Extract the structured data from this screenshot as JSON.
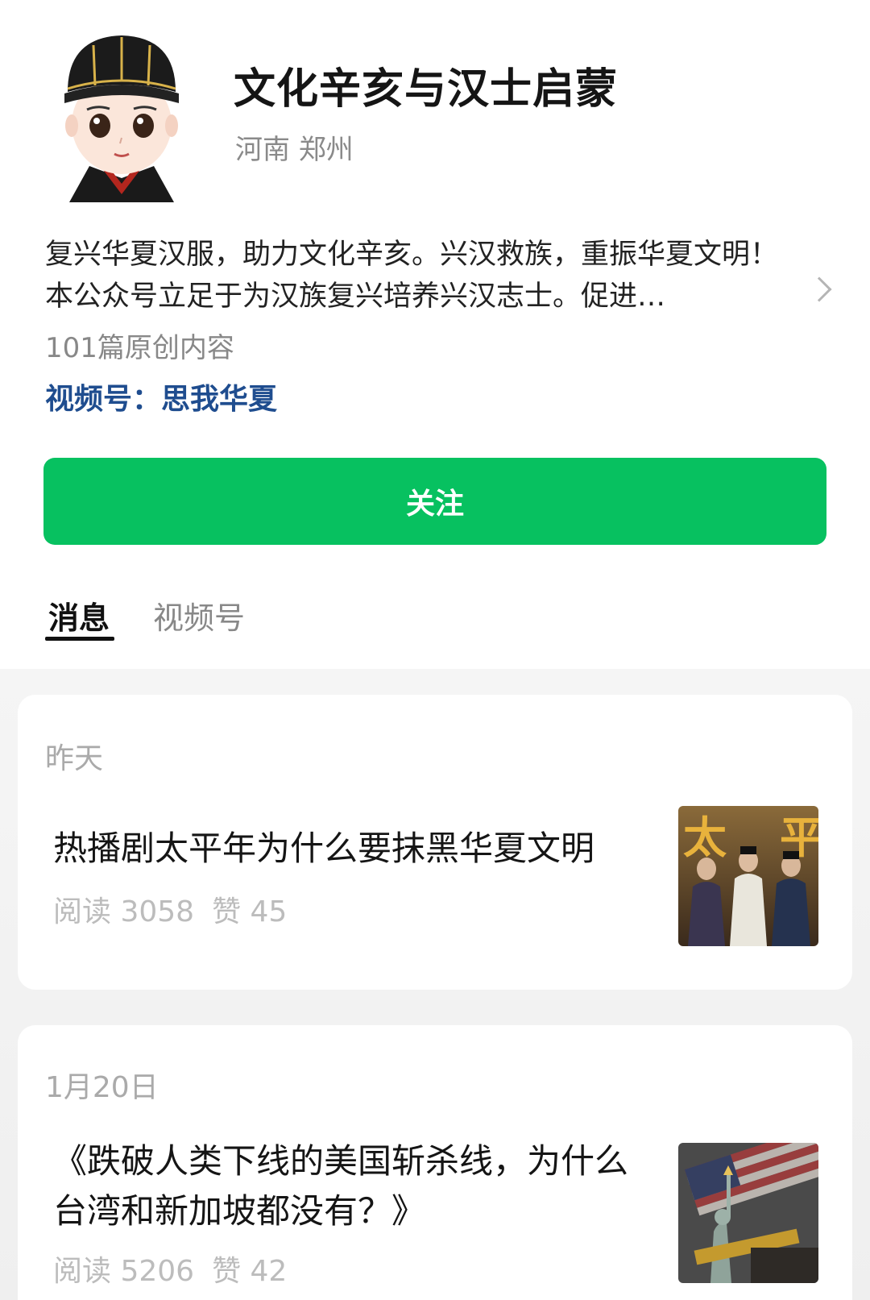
{
  "account": {
    "name": "文化辛亥与汉士启蒙",
    "location": "河南 郑州",
    "intro": "复兴华夏汉服，助力文化辛亥。兴汉救族，重振华夏文明！本公众号立足于为汉族复兴培养兴汉志士。促进…",
    "original_count": "101篇原创内容",
    "channels_label": "视频号：",
    "channels_name": "思我华夏"
  },
  "follow_button": {
    "label": "关注",
    "color": "#07c160"
  },
  "tabs": [
    {
      "label": "消息",
      "active": true
    },
    {
      "label": "视频号",
      "active": false
    }
  ],
  "articles": [
    {
      "date": "昨天",
      "title": "热播剧太平年为什么要抹黑华夏文明",
      "reads": "阅读 3058",
      "likes": "赞 45",
      "thumb_icon": "drama-poster-image"
    },
    {
      "date": "1月20日",
      "title": "《跌破人类下线的美国斩杀线，为什么台湾和新加坡都没有？》",
      "reads": "阅读 5206",
      "likes": "赞 42",
      "thumb_icon": "statue-of-liberty-image"
    }
  ]
}
